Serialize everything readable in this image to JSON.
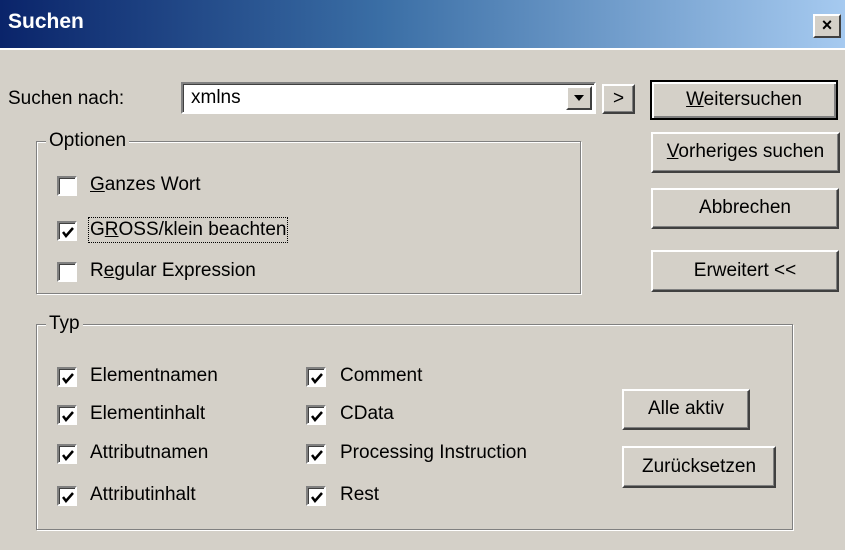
{
  "window": {
    "title": "Suchen",
    "close_glyph": "×"
  },
  "search": {
    "label": "Suchen nach:",
    "value": "xmlns",
    "expand_glyph": ">"
  },
  "buttons": {
    "find_next": {
      "mnemonic": "W",
      "rest": "eitersuchen"
    },
    "find_prev": {
      "mnemonic": "V",
      "rest": "orheriges suchen"
    },
    "cancel": "Abbrechen",
    "advanced": "Erweitert <<",
    "all_active": "Alle aktiv",
    "reset": "Zurücksetzen"
  },
  "options": {
    "legend": "Optionen",
    "items": [
      {
        "pre": "",
        "mnemonic": "G",
        "post": "anzes Wort",
        "checked": false
      },
      {
        "pre": "G",
        "mnemonic": "R",
        "post": "OSS/klein beachten",
        "checked": true
      },
      {
        "pre": "R",
        "mnemonic": "e",
        "post": "gular Expression",
        "checked": false
      }
    ]
  },
  "typ": {
    "legend": "Typ",
    "col1": [
      {
        "label": "Elementnamen",
        "checked": true
      },
      {
        "label": "Elementinhalt",
        "checked": true
      },
      {
        "label": "Attributnamen",
        "checked": true
      },
      {
        "label": "Attributinhalt",
        "checked": true
      }
    ],
    "col2": [
      {
        "label": "Comment",
        "checked": true
      },
      {
        "label": "CData",
        "checked": true
      },
      {
        "label": "Processing Instruction",
        "checked": true
      },
      {
        "label": "Rest",
        "checked": true
      }
    ]
  },
  "icons": {
    "checkmark": "checkmark-icon",
    "dropdown": "chevron-down-icon",
    "close": "close-icon"
  }
}
